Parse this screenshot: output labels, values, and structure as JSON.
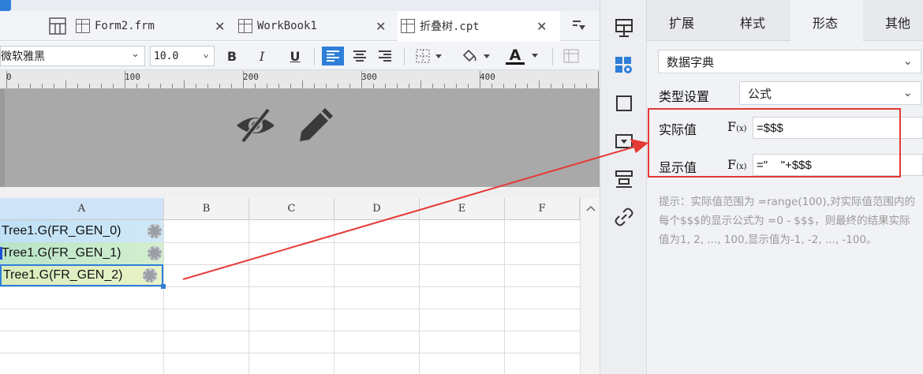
{
  "tabs": [
    {
      "label": "Form2.frm"
    },
    {
      "label": "WorkBook1"
    },
    {
      "label": "折叠树.cpt"
    }
  ],
  "format": {
    "font_name": "微软雅黑",
    "font_size": "10.0",
    "bold": "B",
    "italic": "I",
    "underline": "U",
    "font_color_glyph": "A"
  },
  "ruler": {
    "marks": [
      "0",
      "100",
      "200",
      "300",
      "400"
    ]
  },
  "grid": {
    "columns": [
      "A",
      "B",
      "C",
      "D",
      "E",
      "F"
    ],
    "cells": [
      "Tree1.G(FR_GEN_0)",
      "Tree1.G(FR_GEN_1)",
      "Tree1.G(FR_GEN_2)"
    ]
  },
  "panel": {
    "tabs": [
      "扩展",
      "样式",
      "形态",
      "其他"
    ],
    "widget_type": "数据字典",
    "type_setting_label": "类型设置",
    "type_setting_value": "公式",
    "actual_value_label": "实际值",
    "actual_value": "=$$$",
    "display_value_label": "显示值",
    "display_value": "=\"    \"+$$$",
    "hint": "提示：实际值范围为 =range(100),对实际值范围内的每个$$$的显示公式为 =0 - $$$，则最终的结果实际值为1, 2, ..., 100,显示值为-1, -2, ..., -100。"
  },
  "colors": {
    "accent": "#2f7ed8",
    "highlight_box": "#e53935",
    "selected_cell_border": "#2f7ed8"
  }
}
